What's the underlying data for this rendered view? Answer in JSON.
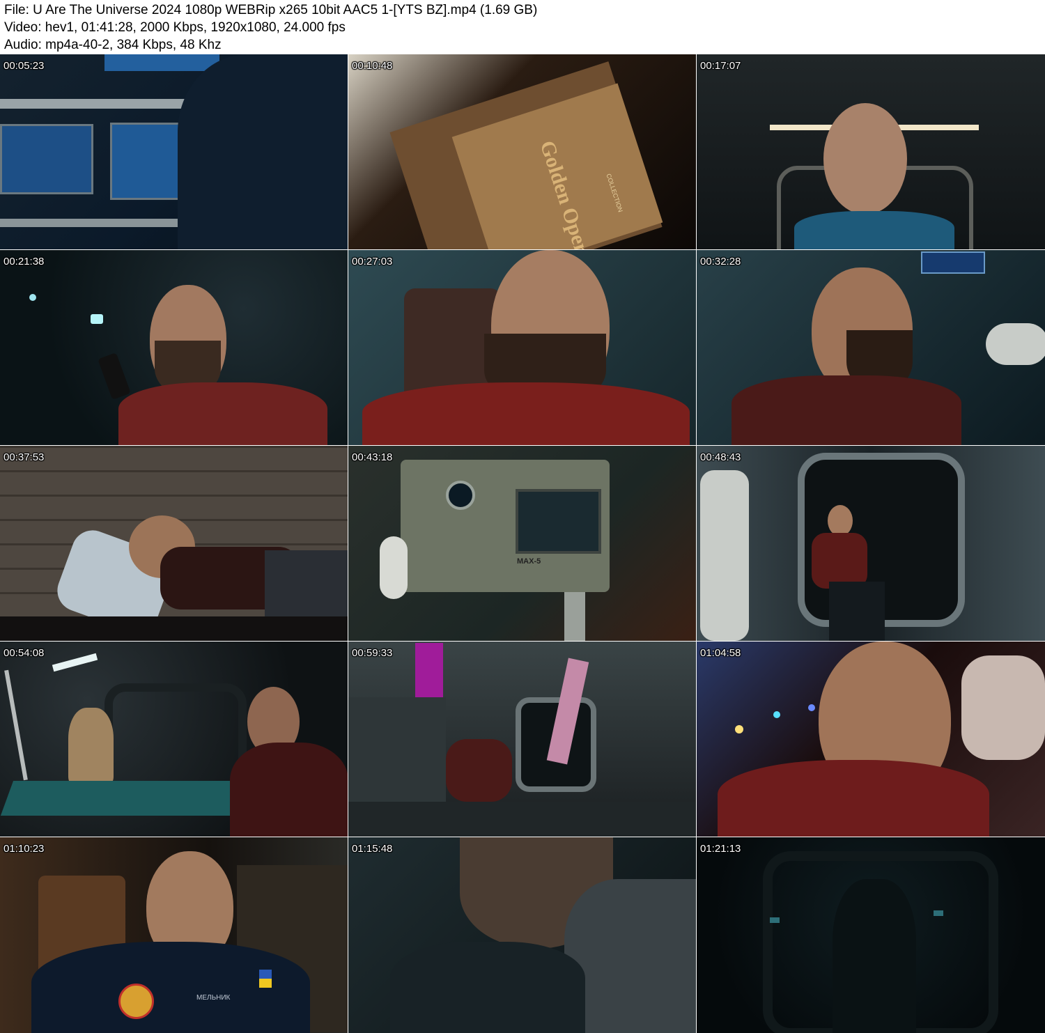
{
  "header": {
    "file_line": "File: U Are The Universe 2024 1080p WEBRip x265 10bit AAC5 1-[YTS BZ].mp4 (1.69 GB)",
    "video_line": "Video: hev1, 01:41:28, 2000 Kbps, 1920x1080, 24.000 fps",
    "audio_line": "Audio: mp4a-40-2, 384 Kbps, 48 Khz"
  },
  "thumbnails": [
    {
      "timestamp": "00:05:23",
      "scene": "control-panel-monitors",
      "colors": [
        "#0b1a2a",
        "#1d4f86",
        "#081018"
      ]
    },
    {
      "timestamp": "00:10:48",
      "scene": "golden-opera-book",
      "colors": [
        "#2a1c12",
        "#a07a4d",
        "#0c0806"
      ],
      "book_title": "Golden Opera",
      "book_subtitle": "COLLECTION"
    },
    {
      "timestamp": "00:17:07",
      "scene": "man-in-corridor",
      "colors": [
        "#101416",
        "#3a4246",
        "#1e5a7a"
      ]
    },
    {
      "timestamp": "00:21:38",
      "scene": "man-on-phone-smiling",
      "colors": [
        "#0a1316",
        "#1f2d33",
        "#6e2220"
      ]
    },
    {
      "timestamp": "00:27:03",
      "scene": "bearded-man-closeup",
      "colors": [
        "#16262b",
        "#2e4a52",
        "#7a1f1c"
      ]
    },
    {
      "timestamp": "00:32:28",
      "scene": "man-profile-with-earpiece",
      "colors": [
        "#0c1a20",
        "#284048",
        "#4a1a18"
      ]
    },
    {
      "timestamp": "00:37:53",
      "scene": "man-lying-in-bunk",
      "colors": [
        "#2a2622",
        "#4e4740",
        "#2b1513"
      ]
    },
    {
      "timestamp": "00:43:18",
      "scene": "robot-max-5",
      "colors": [
        "#1c2624",
        "#6d7464",
        "#3a2014"
      ],
      "robot_label": "MAX-5"
    },
    {
      "timestamp": "00:48:43",
      "scene": "man-sitting-hatch",
      "colors": [
        "#1a2226",
        "#3e4c52",
        "#5a1a18"
      ]
    },
    {
      "timestamp": "00:54:08",
      "scene": "man-at-table-with-bust",
      "colors": [
        "#0e1214",
        "#1d5c5e",
        "#3e1414"
      ]
    },
    {
      "timestamp": "00:59:33",
      "scene": "man-on-floor-module",
      "colors": [
        "#1a1e20",
        "#3a4446",
        "#a01c9a"
      ]
    },
    {
      "timestamp": "01:04:58",
      "scene": "man-with-lights",
      "colors": [
        "#1a0c0c",
        "#6e1c1c",
        "#2a3a6a"
      ]
    },
    {
      "timestamp": "01:10:23",
      "scene": "man-in-uniform-reading",
      "colors": [
        "#15110e",
        "#3e2b1c",
        "#0d1a2c"
      ],
      "name_tag": "МЕЛЬНИК"
    },
    {
      "timestamp": "01:15:48",
      "scene": "man-head-down-blanket",
      "colors": [
        "#0b1214",
        "#1f2c30",
        "#3a4246"
      ]
    },
    {
      "timestamp": "01:21:13",
      "scene": "man-from-behind-dark",
      "colors": [
        "#050a0c",
        "#0f1c20",
        "#2d6e78"
      ]
    }
  ]
}
